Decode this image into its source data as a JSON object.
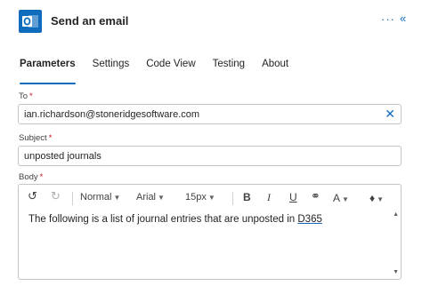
{
  "header": {
    "title": "Send an email",
    "more_icon": "···",
    "collapse_icon": "«"
  },
  "tabs": [
    {
      "label": "Parameters",
      "active": true
    },
    {
      "label": "Settings"
    },
    {
      "label": "Code View"
    },
    {
      "label": "Testing"
    },
    {
      "label": "About"
    }
  ],
  "fields": {
    "to": {
      "label": "To",
      "required": "*",
      "value": "ian.richardson@stoneridgesoftware.com"
    },
    "subject": {
      "label": "Subject",
      "required": "*",
      "value": "unposted journals"
    },
    "body": {
      "label": "Body",
      "required": "*",
      "text_before": "The following is a list of journal entries that are unposted in ",
      "text_flagged": "D365"
    }
  },
  "toolbar": {
    "undo": "↺",
    "redo": "↻",
    "format": "Normal",
    "font": "Arial",
    "size": "15px",
    "bold": "B",
    "italic": "I",
    "underline": "U",
    "link": "⚭",
    "text_color": "A",
    "highlight": "♦"
  },
  "colors": {
    "accent": "#0f6cbd",
    "required": "#c50f1f"
  }
}
